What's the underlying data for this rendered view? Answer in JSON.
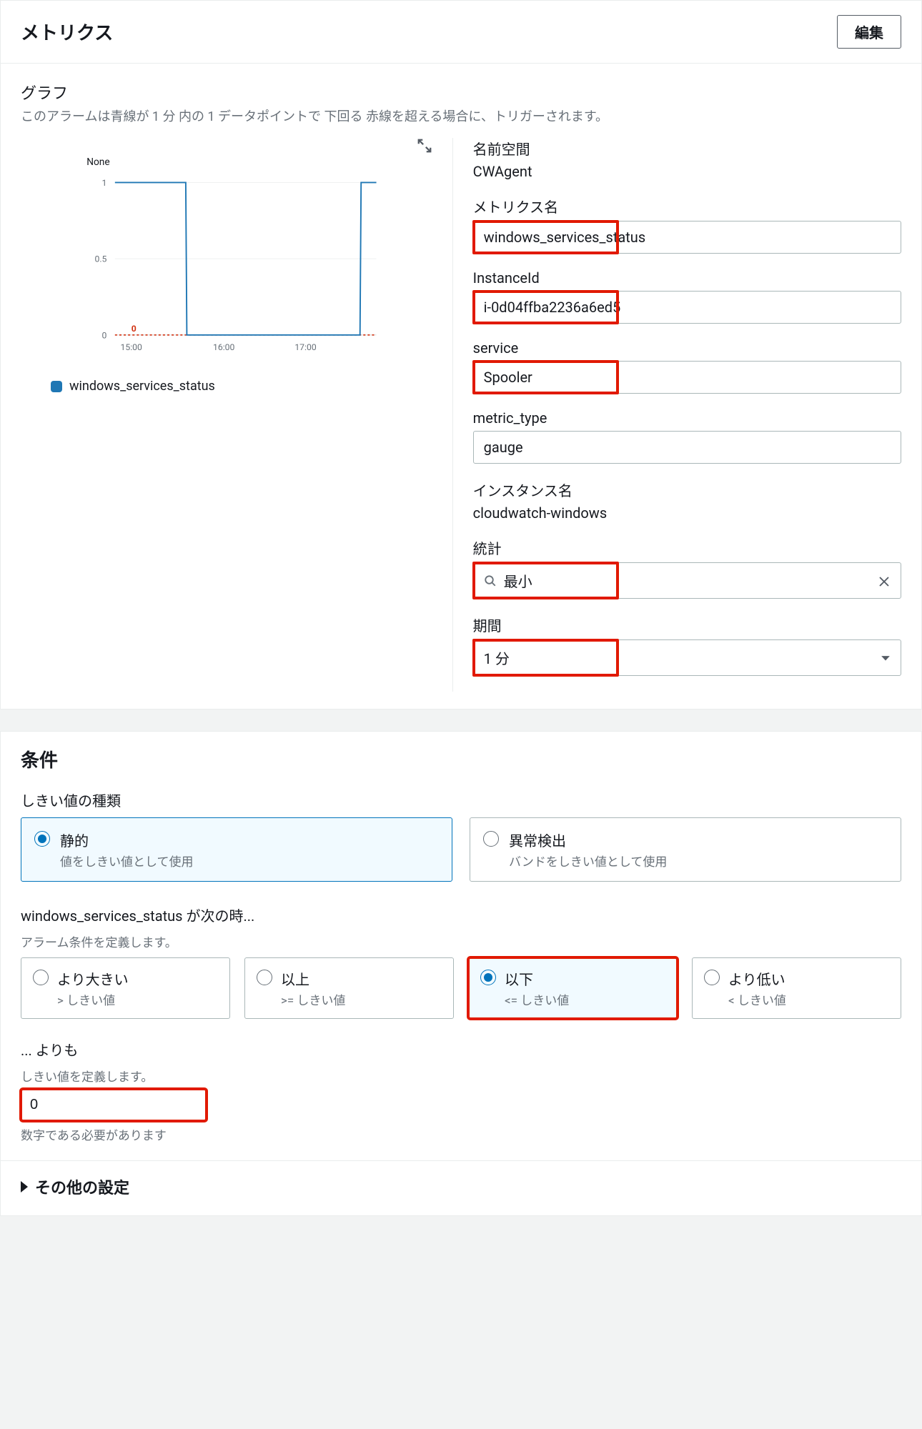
{
  "metrics_panel": {
    "title": "メトリクス",
    "edit_button": "編集",
    "graph_label": "グラフ",
    "graph_desc": "このアラームは青線が 1 分 内の 1 データポイントで 下回る 赤線を超える場合に、トリガーされます。",
    "y_label_none": "None",
    "legend": "windows_services_status",
    "threshold_value": "0",
    "fields": {
      "namespace_label": "名前空間",
      "namespace_value": "CWAgent",
      "metric_name_label": "メトリクス名",
      "metric_name_value": "windows_services_status",
      "instance_id_label": "InstanceId",
      "instance_id_value": "i-0d04ffba2236a6ed5",
      "service_label": "service",
      "service_value": "Spooler",
      "metric_type_label": "metric_type",
      "metric_type_value": "gauge",
      "instance_name_label": "インスタンス名",
      "instance_name_value": "cloudwatch-windows",
      "statistic_label": "統計",
      "statistic_value": "最小",
      "period_label": "期間",
      "period_value": "1 分"
    }
  },
  "conditions_panel": {
    "title": "条件",
    "threshold_type_label": "しきい値の種類",
    "type_static": {
      "title": "静的",
      "sub": "値をしきい値として使用"
    },
    "type_anomaly": {
      "title": "異常検出",
      "sub": "バンドをしきい値として使用"
    },
    "condition_label": "windows_services_status が次の時...",
    "condition_desc": "アラーム条件を定義します。",
    "ops": {
      "gt": {
        "title": "より大きい",
        "sub": "> しきい値"
      },
      "ge": {
        "title": "以上",
        "sub": ">= しきい値"
      },
      "le": {
        "title": "以下",
        "sub": "<= しきい値"
      },
      "lt": {
        "title": "より低い",
        "sub": "< しきい値"
      }
    },
    "than_label": "... よりも",
    "than_desc": "しきい値を定義します。",
    "than_value": "0",
    "than_helper": "数字である必要があります",
    "other_settings": "その他の設定"
  },
  "chart_data": {
    "type": "line",
    "x": [
      "15:00",
      "16:00",
      "17:00"
    ],
    "series": [
      {
        "name": "windows_services_status",
        "points": [
          {
            "x": "15:00",
            "y": 1
          },
          {
            "x": "15:30",
            "y": 1
          },
          {
            "x": "15:35",
            "y": 0
          },
          {
            "x": "17:20",
            "y": 0
          },
          {
            "x": "17:25",
            "y": 1
          },
          {
            "x": "17:30",
            "y": 1
          }
        ]
      },
      {
        "name": "threshold",
        "y_const": 0,
        "color": "red",
        "dashed": true
      }
    ],
    "ylim": [
      0,
      1
    ],
    "yticks": [
      0,
      0.5,
      1
    ],
    "xticks": [
      "15:00",
      "16:00",
      "17:00"
    ],
    "title": "None",
    "annotation": {
      "text": "0",
      "color": "red",
      "y": 0
    }
  }
}
